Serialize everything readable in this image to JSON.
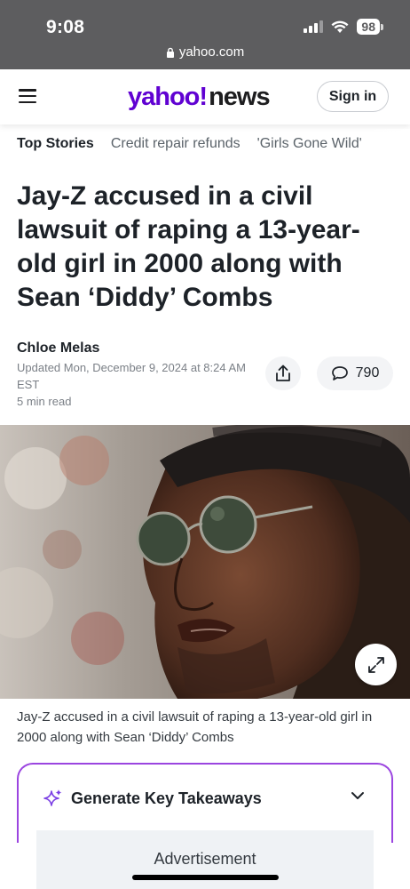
{
  "status_bar": {
    "time": "9:08",
    "battery": "98",
    "url": "yahoo.com"
  },
  "header": {
    "logo_yahoo": "yahoo!",
    "logo_news": "news",
    "signin_label": "Sign in"
  },
  "tabs": [
    {
      "label": "Top Stories",
      "active": true
    },
    {
      "label": "Credit repair refunds",
      "active": false
    },
    {
      "label": "'Girls Gone Wild'",
      "active": false
    }
  ],
  "article": {
    "headline": "Jay-Z accused in a civil lawsuit of raping a 13-year-old girl in 2000 along with Sean ‘Diddy’ Combs",
    "author": "Chloe Melas",
    "updated": "Updated Mon, December 9, 2024 at 8:24 AM EST",
    "read_time": "5 min read",
    "comment_count": "790",
    "caption": "Jay-Z accused in a civil lawsuit of raping a 13-year-old girl in 2000 along with Sean ‘Diddy’ Combs"
  },
  "takeaways": {
    "label": "Generate Key Takeaways"
  },
  "ad": {
    "label": "Advertisement"
  },
  "colors": {
    "brand_purple": "#6001d2",
    "takeaways_border": "#9b45e0",
    "status_bar_bg": "#5d5d5f"
  }
}
